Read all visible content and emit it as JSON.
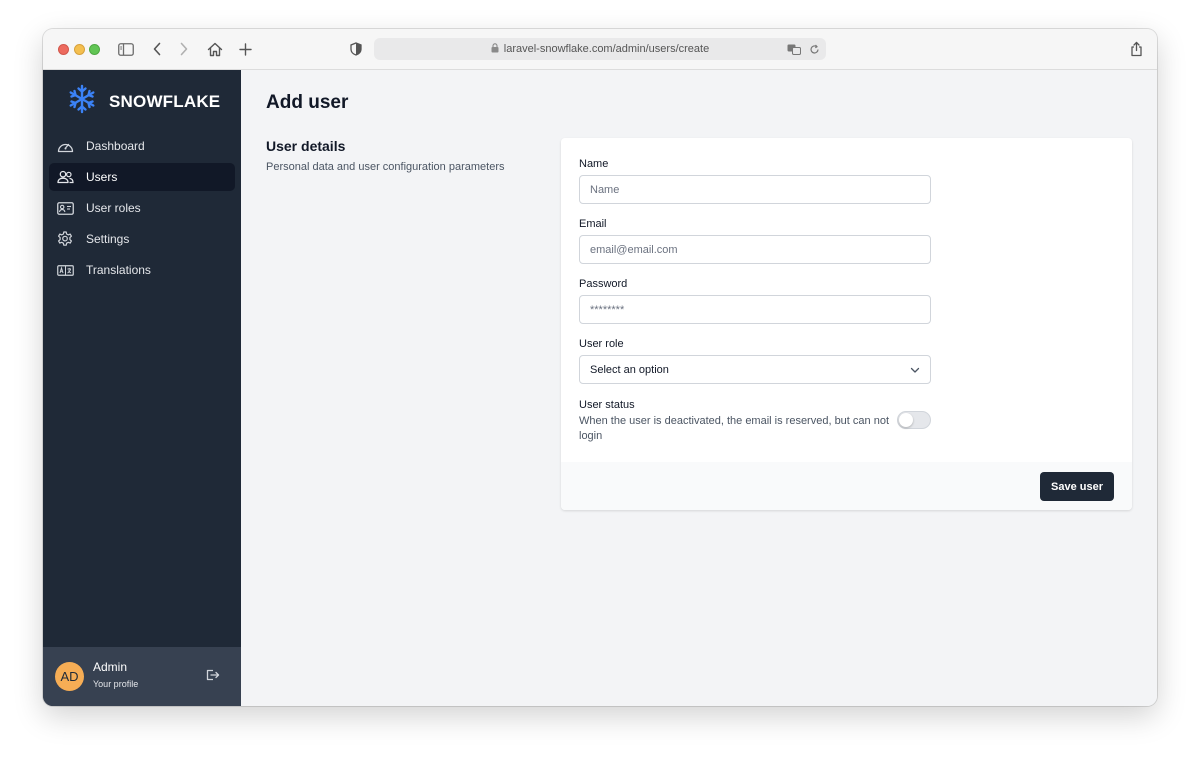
{
  "browser": {
    "url": "laravel-snowflake.com/admin/users/create"
  },
  "app": {
    "brand_name": "SNOWFLAKE"
  },
  "sidebar": {
    "items": [
      {
        "label": "Dashboard",
        "icon": "dashboard-icon",
        "active": false
      },
      {
        "label": "Users",
        "icon": "users-icon",
        "active": true
      },
      {
        "label": "User roles",
        "icon": "id-card-icon",
        "active": false
      },
      {
        "label": "Settings",
        "icon": "gear-icon",
        "active": false
      },
      {
        "label": "Translations",
        "icon": "translations-icon",
        "active": false
      }
    ],
    "profile": {
      "initials": "AD",
      "name": "Admin",
      "subtitle": "Your profile"
    }
  },
  "main": {
    "title": "Add user",
    "section_title": "User details",
    "section_description": "Personal data and user configuration parameters",
    "form": {
      "name": {
        "label": "Name",
        "placeholder": "Name",
        "value": ""
      },
      "email": {
        "label": "Email",
        "placeholder": "email@email.com",
        "value": ""
      },
      "password": {
        "label": "Password",
        "placeholder": "********",
        "value": ""
      },
      "role": {
        "label": "User role",
        "selected": "Select an option"
      },
      "status": {
        "label": "User status",
        "description": "When the user is deactivated, the email is reserved, but can not login",
        "enabled": false
      },
      "save_label": "Save user"
    }
  },
  "colors": {
    "sidebar_bg": "#1f2937",
    "sidebar_active": "#111827",
    "accent": "#3b82f6",
    "avatar_bg": "#f6ad55",
    "button_bg": "#1f2937"
  }
}
